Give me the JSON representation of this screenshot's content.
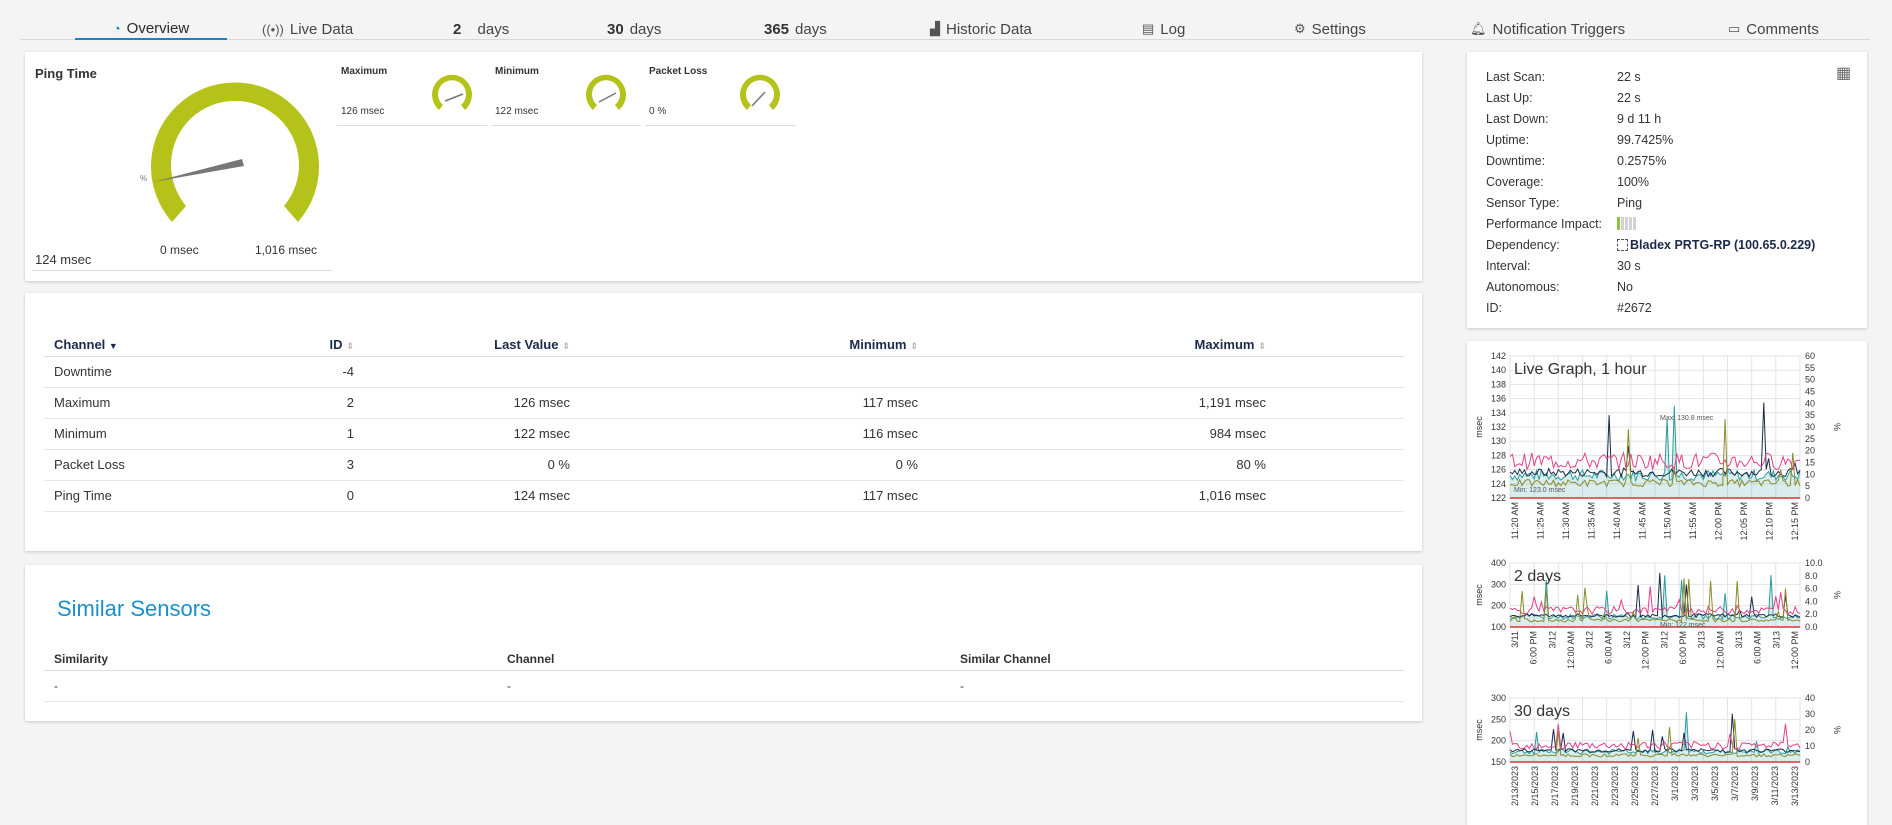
{
  "tabs": [
    {
      "label": "Overview",
      "icon": "gauge-icon"
    },
    {
      "label": "Live Data",
      "icon": "broadcast-icon"
    },
    {
      "number": "2",
      "label": "days"
    },
    {
      "number": "30",
      "label": "days"
    },
    {
      "number": "365",
      "label": "days"
    },
    {
      "label": "Historic Data",
      "icon": "area-chart-icon"
    },
    {
      "label": "Log",
      "icon": "list-icon"
    },
    {
      "label": "Settings",
      "icon": "gear-icon"
    },
    {
      "label": "Notification Triggers",
      "icon": "bell-icon"
    },
    {
      "label": "Comments",
      "icon": "comment-icon"
    }
  ],
  "gauges": {
    "main": {
      "title": "Ping Time",
      "value": "124 msec",
      "min": "0 msec",
      "max": "1,016 msec",
      "marker": "%",
      "fraction": 0.12,
      "color": "#b5c21a"
    },
    "small": [
      {
        "title": "Maximum",
        "value": "126 msec",
        "fraction": 0.14
      },
      {
        "title": "Minimum",
        "value": "122 msec",
        "fraction": 0.16
      },
      {
        "title": "Packet Loss",
        "value": "0 %",
        "fraction": 0.0
      }
    ]
  },
  "channels": {
    "headers": [
      "Channel",
      "ID",
      "Last Value",
      "Minimum",
      "Maximum"
    ],
    "rows": [
      {
        "channel": "Downtime",
        "id": "-4",
        "last": "",
        "min": "",
        "max": ""
      },
      {
        "channel": "Maximum",
        "id": "2",
        "last": "126 msec",
        "min": "117 msec",
        "max": "1,191 msec"
      },
      {
        "channel": "Minimum",
        "id": "1",
        "last": "122 msec",
        "min": "116 msec",
        "max": "984 msec"
      },
      {
        "channel": "Packet Loss",
        "id": "3",
        "last": "0 %",
        "min": "0 %",
        "max": "80 %"
      },
      {
        "channel": "Ping Time",
        "id": "0",
        "last": "124 msec",
        "min": "117 msec",
        "max": "1,016 msec"
      }
    ]
  },
  "similar": {
    "title": "Similar Sensors",
    "headers": [
      "Similarity",
      "Channel",
      "Similar Channel"
    ],
    "rows": [
      [
        "-",
        "-",
        "-"
      ]
    ]
  },
  "info": [
    {
      "key": "Last Scan:",
      "value": "22 s"
    },
    {
      "key": "Last Up:",
      "value": "22 s"
    },
    {
      "key": "Last Down:",
      "value": "9 d 11 h"
    },
    {
      "key": "Uptime:",
      "value": "99.7425%"
    },
    {
      "key": "Downtime:",
      "value": "0.2575%"
    },
    {
      "key": "Coverage:",
      "value": "100%"
    },
    {
      "key": "Sensor Type:",
      "value": "Ping"
    },
    {
      "key": "Performance Impact:",
      "value": "",
      "impact_level": 1,
      "impact_total": 5
    },
    {
      "key": "Dependency:",
      "value": "Bladex PRTG-RP (100.65.0.229)",
      "link": true
    },
    {
      "key": "Interval:",
      "value": "30 s"
    },
    {
      "key": "Autonomous:",
      "value": "No"
    },
    {
      "key": "ID:",
      "value": "#2672"
    }
  ],
  "graphs": [
    {
      "title": "Live Graph, 1 hour",
      "ylabel_left": "msec",
      "ylabel_right": "%",
      "y_left": [
        "142",
        "140",
        "138",
        "136",
        "134",
        "132",
        "130",
        "128",
        "126",
        "124",
        "122"
      ],
      "y_right": [
        "60",
        "55",
        "50",
        "45",
        "40",
        "35",
        "30",
        "25",
        "20",
        "15",
        "10",
        "5",
        "0"
      ],
      "x": [
        "11:20 AM",
        "11:25 AM",
        "11:30 AM",
        "11:35 AM",
        "11:40 AM",
        "11:45 AM",
        "11:50 AM",
        "11:55 AM",
        "12:00 PM",
        "12:05 PM",
        "12:10 PM",
        "12:15 PM"
      ],
      "annotations": [
        "Max: 130.8 msec",
        "Min: 123.0 msec"
      ]
    },
    {
      "title": "2 days",
      "ylabel_left": "msec",
      "ylabel_right": "%",
      "y_left": [
        "400",
        "300",
        "200",
        "100"
      ],
      "y_right": [
        "10.0",
        "8.0",
        "6.0",
        "4.0",
        "2.0",
        "0.0"
      ],
      "x": [
        "3/11",
        "6:00 PM",
        "3/12",
        "12:00 AM",
        "3/12",
        "6:00 AM",
        "3/12",
        "12:00 PM",
        "3/12",
        "6:00 PM",
        "3/13",
        "12:00 AM",
        "3/13",
        "6:00 AM",
        "3/13",
        "12:00 PM"
      ],
      "annotations": [
        "Min: 122 msec"
      ]
    },
    {
      "title": "30 days",
      "ylabel_left": "msec",
      "ylabel_right": "%",
      "y_left": [
        "300",
        "250",
        "200",
        "150"
      ],
      "y_right": [
        "40",
        "30",
        "20",
        "10",
        "0"
      ],
      "x": [
        "2/13/2023",
        "2/15/2023",
        "2/17/2023",
        "2/19/2023",
        "2/21/2023",
        "2/23/2023",
        "2/25/2023",
        "2/27/2023",
        "3/1/2023",
        "3/3/2023",
        "3/5/2023",
        "3/7/2023",
        "3/9/2023",
        "3/11/2023",
        "3/13/2023"
      ],
      "annotations": []
    }
  ],
  "colors": {
    "accent": "#1f7fc4",
    "gauge": "#b5c21a",
    "title_blue": "#1a8fc9",
    "series_pink": "#e0408a",
    "series_navy": "#1b2a4a",
    "series_teal": "#2a9d9d",
    "series_olive": "#8a8a2a"
  }
}
